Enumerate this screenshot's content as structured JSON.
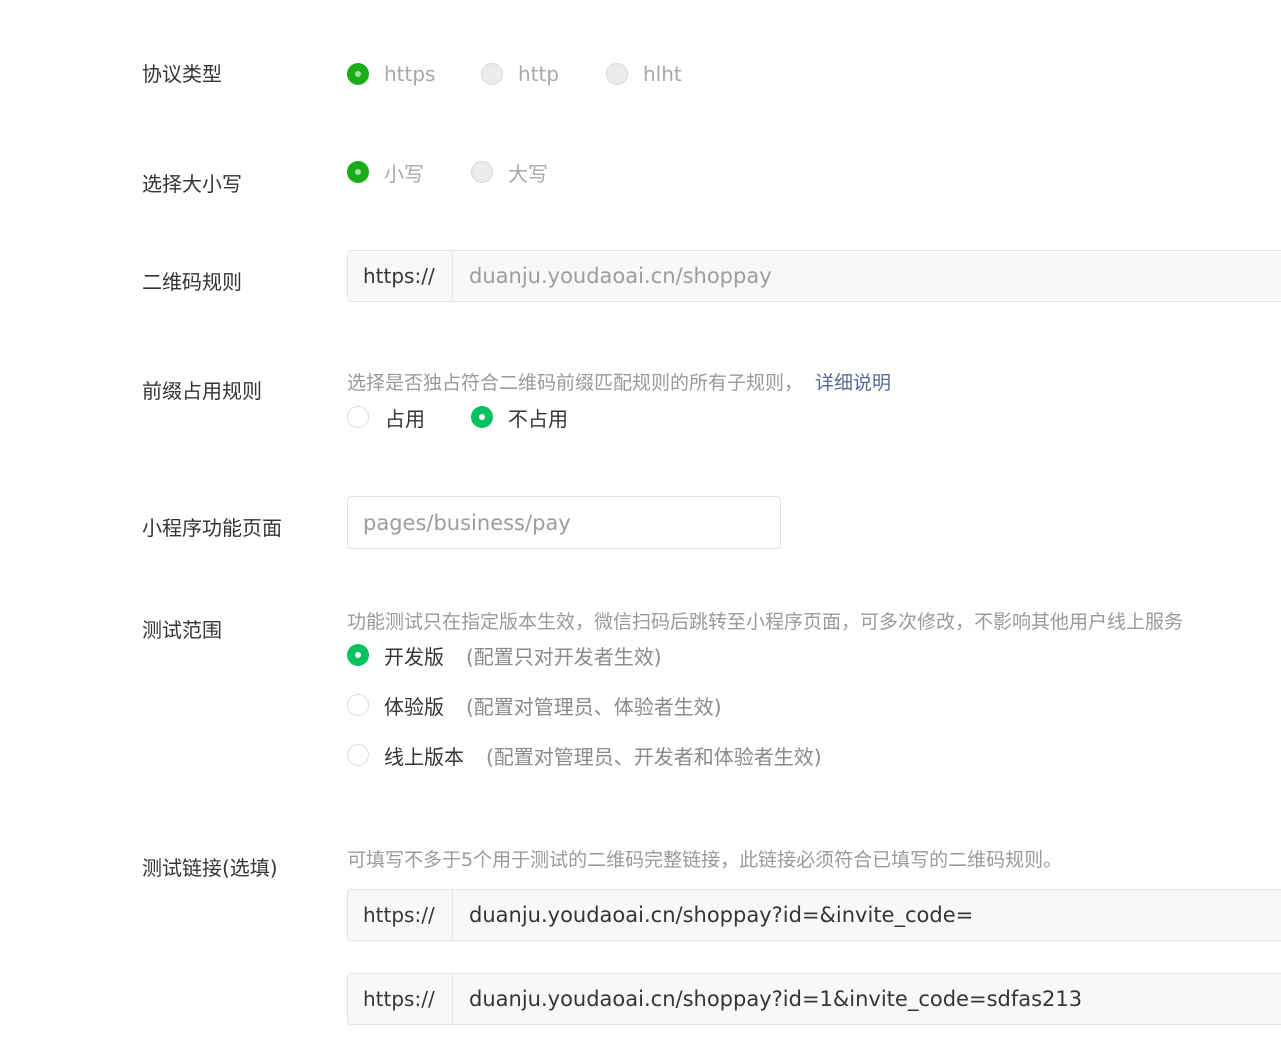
{
  "protocol": {
    "label": "协议类型",
    "options": [
      "https",
      "http",
      "hlht"
    ]
  },
  "case": {
    "label": "选择大小写",
    "options": [
      "小写",
      "大写"
    ]
  },
  "qr_rule": {
    "label": "二维码规则",
    "prefix": "https://",
    "value": "duanju.youdaoai.cn/shoppay"
  },
  "prefix_rule": {
    "label": "前缀占用规则",
    "description": "选择是否独占符合二维码前缀匹配规则的所有子规则，",
    "detail_link": "详细说明",
    "options": [
      "占用",
      "不占用"
    ]
  },
  "page": {
    "label": "小程序功能页面",
    "value": "pages/business/pay"
  },
  "test_scope": {
    "label": "测试范围",
    "description": "功能测试只在指定版本生效，微信扫码后跳转至小程序页面，可多次修改，不影响其他用户线上服务",
    "options": [
      {
        "label": "开发版",
        "note": "(配置只对开发者生效)"
      },
      {
        "label": "体验版",
        "note": "(配置对管理员、体验者生效)"
      },
      {
        "label": "线上版本",
        "note": "(配置对管理员、开发者和体验者生效)"
      }
    ]
  },
  "test_links": {
    "label": "测试链接(选填)",
    "description": "可填写不多于5个用于测试的二维码完整链接，此链接必须符合已填写的二维码规则。",
    "links": [
      {
        "prefix": "https://",
        "value": "duanju.youdaoai.cn/shoppay?id=&invite_code="
      },
      {
        "prefix": "https://",
        "value": "duanju.youdaoai.cn/shoppay?id=1&invite_code=sdfas213"
      }
    ]
  },
  "colors": {
    "accent": "#1aad19",
    "accent2": "#07c160",
    "link": "#576b95"
  }
}
